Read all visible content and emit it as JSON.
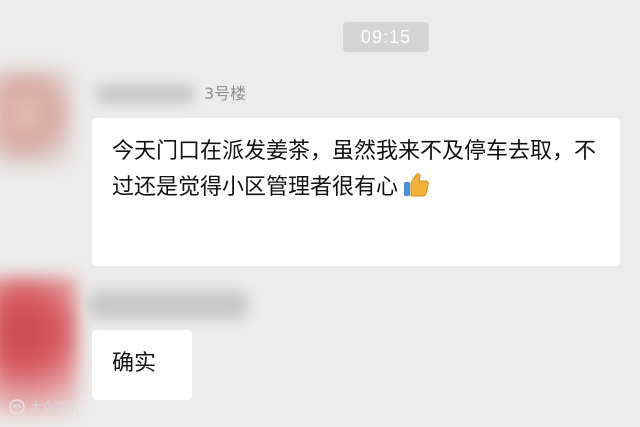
{
  "chat": {
    "timestamp": "09:15",
    "messages": [
      {
        "sender_tag": "3号楼",
        "text": "今天门口在派发姜茶，虽然我来不及停车去取，不过还是觉得小区管理者很有心",
        "emoji": "thumbs-up-emoji"
      },
      {
        "sender_tag": "",
        "text": "确实"
      }
    ]
  },
  "watermark": {
    "text": "大众资讯"
  },
  "colors": {
    "background": "#ececec",
    "bubble": "#ffffff",
    "timestamp_bg": "#d4d4d4"
  }
}
